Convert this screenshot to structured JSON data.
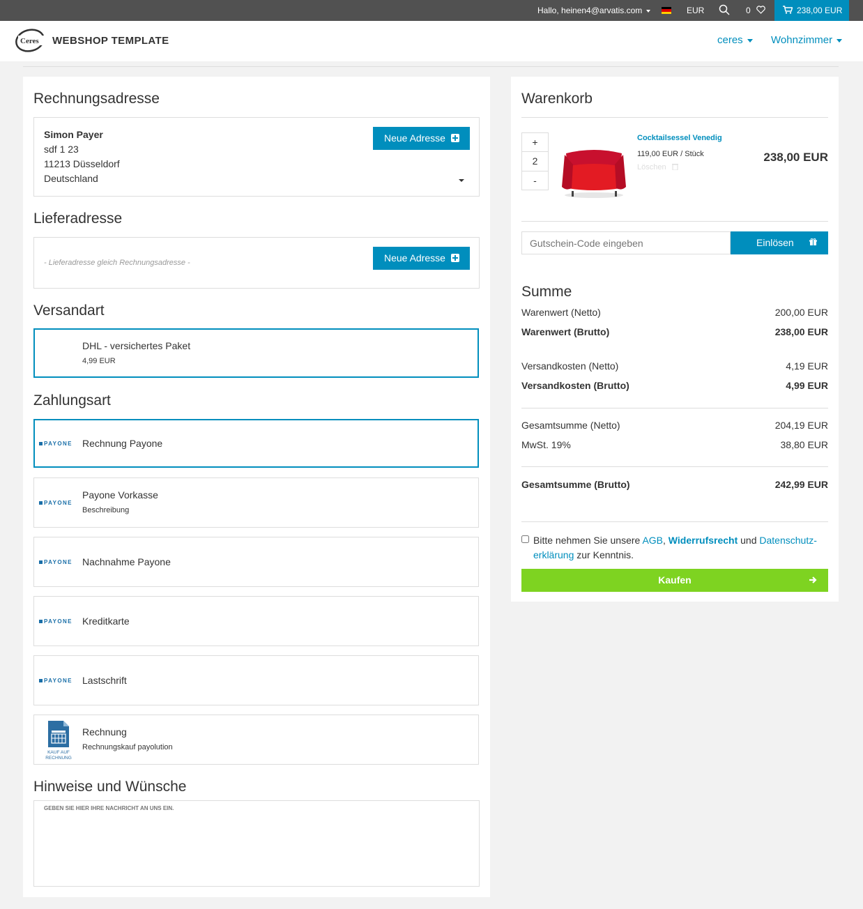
{
  "topbar": {
    "greeting": "Hallo, heinen4@arvatis.com",
    "currency": "EUR",
    "wishlist_count": "0",
    "cart_total": "238,00 EUR"
  },
  "header": {
    "logo_text": "Ceres",
    "brand": "WEBSHOP TEMPLATE",
    "nav": [
      "ceres",
      "Wohnzimmer"
    ]
  },
  "billing": {
    "title": "Rechnungsadresse",
    "name": "Simon Payer",
    "street": "sdf 1 23",
    "city": "11213 Düsseldorf",
    "country": "Deutschland",
    "new_address": "Neue Adresse"
  },
  "delivery": {
    "title": "Lieferadresse",
    "note": "- Lieferadresse gleich Rechnungsadresse -",
    "new_address": "Neue Adresse"
  },
  "shipping": {
    "title": "Versandart",
    "name": "DHL - versichertes Paket",
    "price": "4,99 EUR"
  },
  "payment": {
    "title": "Zahlungsart",
    "provider_logo": "PAYONE",
    "methods": [
      {
        "name": "Rechnung Payone",
        "desc": ""
      },
      {
        "name": "Payone Vorkasse",
        "desc": "Beschreibung"
      },
      {
        "name": "Nachnahme Payone",
        "desc": ""
      },
      {
        "name": "Kreditkarte",
        "desc": ""
      },
      {
        "name": "Lastschrift",
        "desc": ""
      },
      {
        "name": "Rechnung",
        "desc": "Rechnungskauf payolution"
      }
    ],
    "invoice_icon_label_1": "KAUF AUF",
    "invoice_icon_label_2": "RECHNUNG"
  },
  "notes": {
    "title": "Hinweise und Wünsche",
    "placeholder": "GEBEN SIE HIER IHRE NACHRICHT AN UNS EIN."
  },
  "cart": {
    "title": "Warenkorb",
    "item": {
      "name": "Cocktailsessel Venedig",
      "unit_price": "119,00 EUR / Stück",
      "delete": "Löschen",
      "quantity": "2",
      "total": "238,00 EUR",
      "plus": "+",
      "minus": "-"
    },
    "coupon_placeholder": "Gutschein-Code eingeben",
    "coupon_button": "Einlösen"
  },
  "summary": {
    "title": "Summe",
    "rows": [
      {
        "label": "Warenwert (Netto)",
        "value": "200,00 EUR"
      },
      {
        "label": "Warenwert (Brutto)",
        "value": "238,00 EUR"
      },
      {
        "label": "Versandkosten (Netto)",
        "value": "4,19 EUR"
      },
      {
        "label": "Versandkosten (Brutto)",
        "value": "4,99 EUR"
      },
      {
        "label": "Gesamtsumme (Netto)",
        "value": "204,19 EUR"
      },
      {
        "label": "MwSt. 19%",
        "value": "38,80 EUR"
      },
      {
        "label": "Gesamtsumme (Brutto)",
        "value": "242,99 EUR"
      }
    ]
  },
  "terms": {
    "t1": "Bitte nehmen Sie unsere ",
    "agb": "AGB",
    "comma": ",",
    "widerruf": "Widerrufsrecht",
    "und": " und ",
    "datenschutz1": "Datenschutz-",
    "datenschutz2": "erklärung",
    "t2": " zur Kenntnis."
  },
  "buy_button": "Kaufen",
  "colors": {
    "accent": "#008ebd",
    "buy": "#7ed321",
    "topbar": "#515151"
  }
}
